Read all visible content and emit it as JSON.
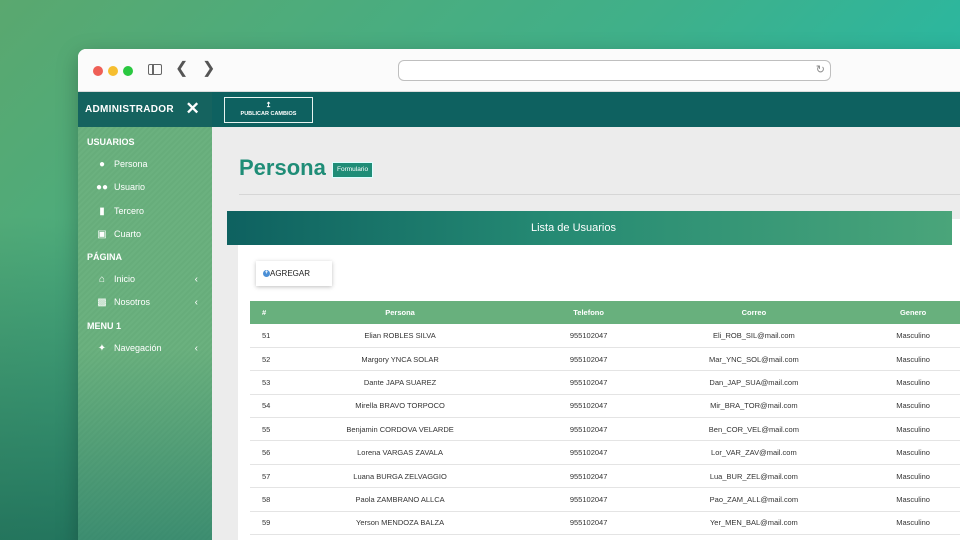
{
  "sidebar": {
    "title": "ADMINISTRADOR",
    "sections": [
      {
        "title": "USUARIOS",
        "items": [
          {
            "label": "Persona",
            "icon": "user-icon"
          },
          {
            "label": "Usuario",
            "icon": "users-icon"
          },
          {
            "label": "Tercero",
            "icon": "file-icon"
          },
          {
            "label": "Cuarto",
            "icon": "id-image-icon"
          }
        ]
      },
      {
        "title": "PÁGINA",
        "items": [
          {
            "label": "Inicio",
            "icon": "home-icon"
          },
          {
            "label": "Nosotros",
            "icon": "id-card-icon"
          }
        ]
      },
      {
        "title": "MENU 1",
        "items": [
          {
            "label": "Navegación",
            "icon": "twitter-icon"
          }
        ]
      }
    ]
  },
  "topbar": {
    "publish_label": "PUBLICAR CAMBIOS"
  },
  "page": {
    "title": "Persona",
    "badge": "Formulario"
  },
  "card": {
    "title": "Lista de Usuarios",
    "add_label": "AGREGAR"
  },
  "table": {
    "headers": [
      "#",
      "Persona",
      "Telefono",
      "Correo",
      "Genero"
    ],
    "rows": [
      [
        "51",
        "Elian ROBLES SILVA",
        "955102047",
        "Eli_ROB_SIL@mail.com",
        "Masculino"
      ],
      [
        "52",
        "Margory YNCA SOLAR",
        "955102047",
        "Mar_YNC_SOL@mail.com",
        "Masculino"
      ],
      [
        "53",
        "Dante JAPA SUAREZ",
        "955102047",
        "Dan_JAP_SUA@mail.com",
        "Masculino"
      ],
      [
        "54",
        "Mirella BRAVO TORPOCO",
        "955102047",
        "Mir_BRA_TOR@mail.com",
        "Masculino"
      ],
      [
        "55",
        "Benjamin CORDOVA VELARDE",
        "955102047",
        "Ben_COR_VEL@mail.com",
        "Masculino"
      ],
      [
        "56",
        "Lorena VARGAS ZAVALA",
        "955102047",
        "Lor_VAR_ZAV@mail.com",
        "Masculino"
      ],
      [
        "57",
        "Luana BURGA ZELVAGGIO",
        "955102047",
        "Lua_BUR_ZEL@mail.com",
        "Masculino"
      ],
      [
        "58",
        "Paola ZAMBRANO ALLCA",
        "955102047",
        "Pao_ZAM_ALL@mail.com",
        "Masculino"
      ],
      [
        "59",
        "Yerson MENDOZA BALZA",
        "955102047",
        "Yer_MEN_BAL@mail.com",
        "Masculino"
      ]
    ]
  },
  "colors": {
    "primary_dark": "#0e6160",
    "accent": "#1f8d77",
    "sidebar": "#6bb17f"
  }
}
